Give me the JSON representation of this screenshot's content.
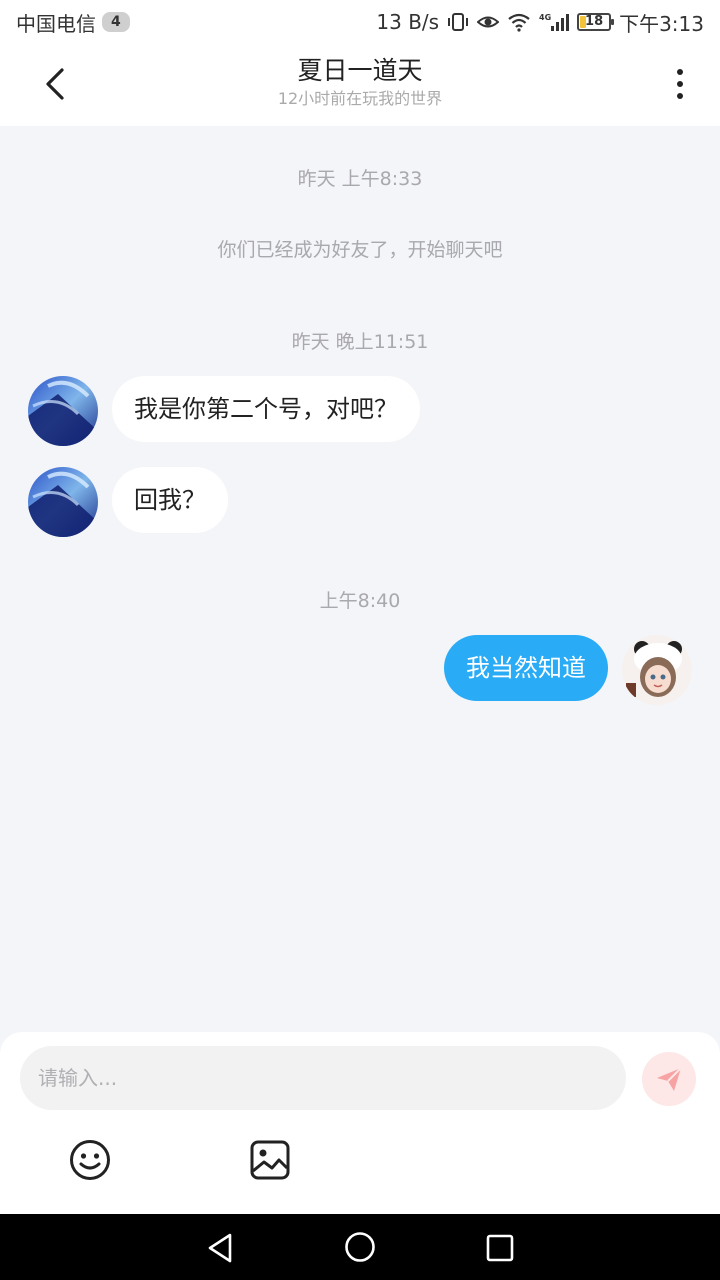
{
  "status_bar": {
    "carrier": "中国电信",
    "sim_badge": "4",
    "network_speed": "13 B/s",
    "battery_level": "18",
    "time": "下午3:13"
  },
  "header": {
    "title": "夏日一道天",
    "subtitle": "12小时前在玩我的世界"
  },
  "chat": {
    "timestamp_1": "昨天 上午8:33",
    "system_message": "你们已经成为好友了，开始聊天吧",
    "timestamp_2": "昨天 晚上11:51",
    "messages": [
      {
        "direction": "incoming",
        "text": "我是你第二个号，对吧？"
      },
      {
        "direction": "incoming",
        "text": "回我？"
      },
      {
        "direction": "outgoing",
        "text": "我当然知道"
      }
    ],
    "timestamp_3": "上午8:40"
  },
  "composer": {
    "placeholder": "请输入...",
    "value": ""
  },
  "colors": {
    "accent": "#2aabf5",
    "send_button_bg": "#fde7e7",
    "send_icon": "#f7a3a3",
    "background": "#f4f5f8"
  },
  "icons": {
    "back": "chevron-left-icon",
    "more": "more-vertical-icon",
    "send": "paper-plane-icon",
    "emoji": "smiley-icon",
    "image": "image-icon"
  }
}
